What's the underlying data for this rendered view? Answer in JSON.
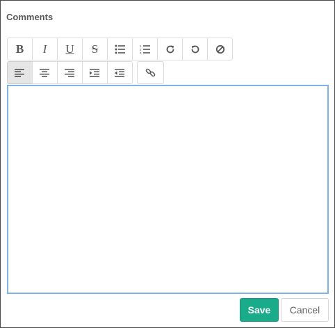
{
  "panel": {
    "title": "Comments"
  },
  "toolbar": {
    "row1": [
      {
        "name": "bold-button",
        "icon": "bold-icon",
        "glyph": "B"
      },
      {
        "name": "italic-button",
        "icon": "italic-icon",
        "glyph": "I"
      },
      {
        "name": "underline-button",
        "icon": "underline-icon",
        "glyph": "U"
      },
      {
        "name": "strikethrough-button",
        "icon": "strikethrough-icon",
        "glyph": "S"
      },
      {
        "name": "bullet-list-button",
        "icon": "bullet-list-icon"
      },
      {
        "name": "numbered-list-button",
        "icon": "numbered-list-icon"
      },
      {
        "name": "redo-button",
        "icon": "redo-icon"
      },
      {
        "name": "undo-button",
        "icon": "undo-icon"
      },
      {
        "name": "clear-format-button",
        "icon": "clear-format-icon"
      }
    ],
    "row2": [
      {
        "name": "align-left-button",
        "icon": "align-left-icon",
        "active": true
      },
      {
        "name": "align-center-button",
        "icon": "align-center-icon"
      },
      {
        "name": "align-right-button",
        "icon": "align-right-icon"
      },
      {
        "name": "indent-button",
        "icon": "indent-icon"
      },
      {
        "name": "outdent-button",
        "icon": "outdent-icon"
      },
      {
        "name": "link-button",
        "icon": "link-icon"
      }
    ]
  },
  "editor": {
    "value": ""
  },
  "actions": {
    "save_label": "Save",
    "cancel_label": "Cancel"
  },
  "colors": {
    "accent": "#1aab8a",
    "focus_border": "#7fb2e5"
  }
}
